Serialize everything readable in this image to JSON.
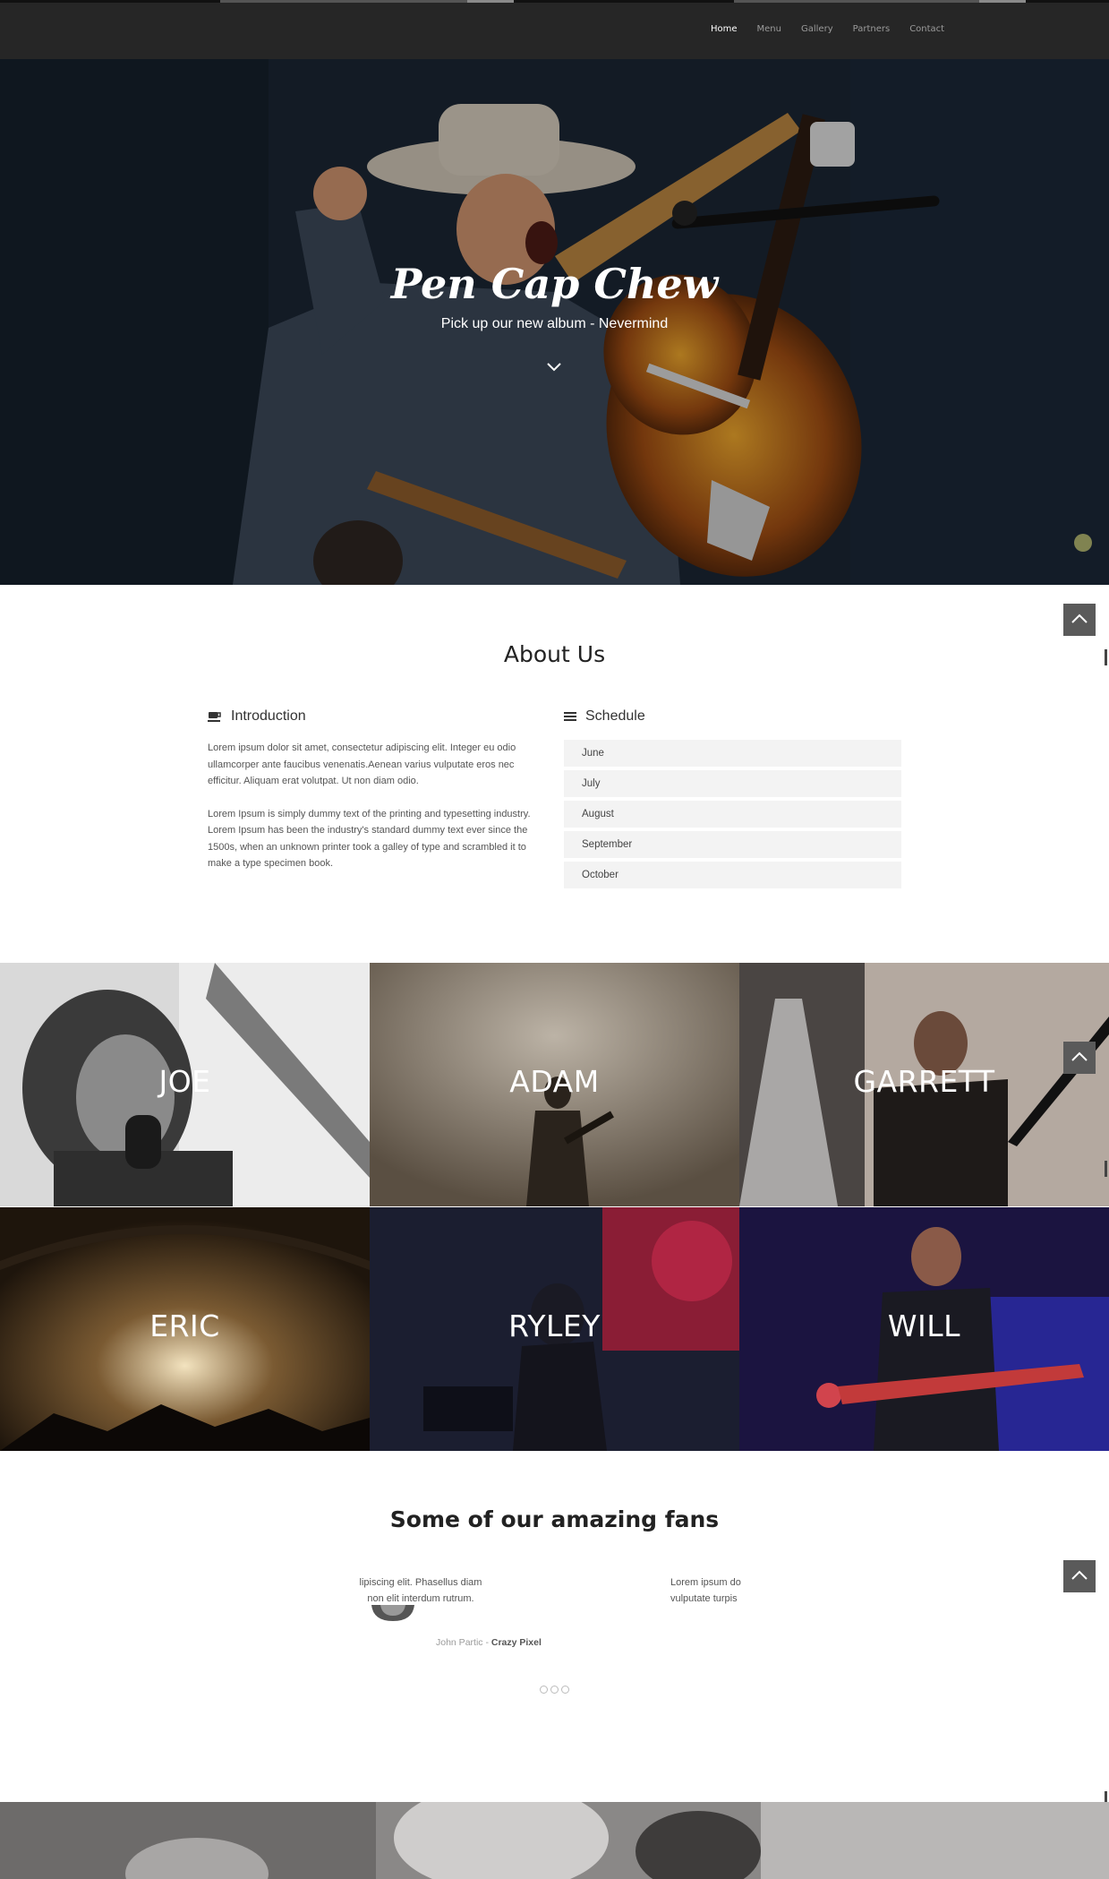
{
  "nav": {
    "items": [
      "Home",
      "Menu",
      "Gallery",
      "Partners",
      "Contact"
    ]
  },
  "hero": {
    "title": "Pen Cap Chew",
    "subtitle": "Pick up our new album - Nevermind"
  },
  "about": {
    "title": "About Us",
    "intro": {
      "heading": "Introduction",
      "p1": "Lorem ipsum dolor sit amet, consectetur adipiscing elit. Integer eu odio ullamcorper ante faucibus venenatis.Aenean varius vulputate eros nec efficitur. Aliquam erat volutpat. Ut non diam odio.",
      "p2": "Lorem Ipsum is simply dummy text of the printing and typesetting industry. Lorem Ipsum has been the industry's standard dummy text ever since the 1500s, when an unknown printer took a galley of type and scrambled it to make a type specimen book."
    },
    "schedule": {
      "heading": "Schedule",
      "months": [
        "June",
        "July",
        "August",
        "September",
        "October"
      ]
    }
  },
  "members": [
    "JOE",
    "ADAM",
    "GARRETT",
    "ERIC",
    "RYLEY",
    "WILL"
  ],
  "fans": {
    "title": "Some of our amazing fans",
    "quote_left": "lipiscing elit. Phasellus diam non elit interdum rutrum.",
    "quote_right_l1": "Lorem ipsum do",
    "quote_right_l2": "vulputate turpis",
    "author_name": "John Partic",
    "author_sep": " - ",
    "author_company": "Crazy Pixel"
  },
  "colors": {
    "nav_bg": "#262626",
    "accent": "#ffffff",
    "totop_bg": "#5a5a5a"
  }
}
